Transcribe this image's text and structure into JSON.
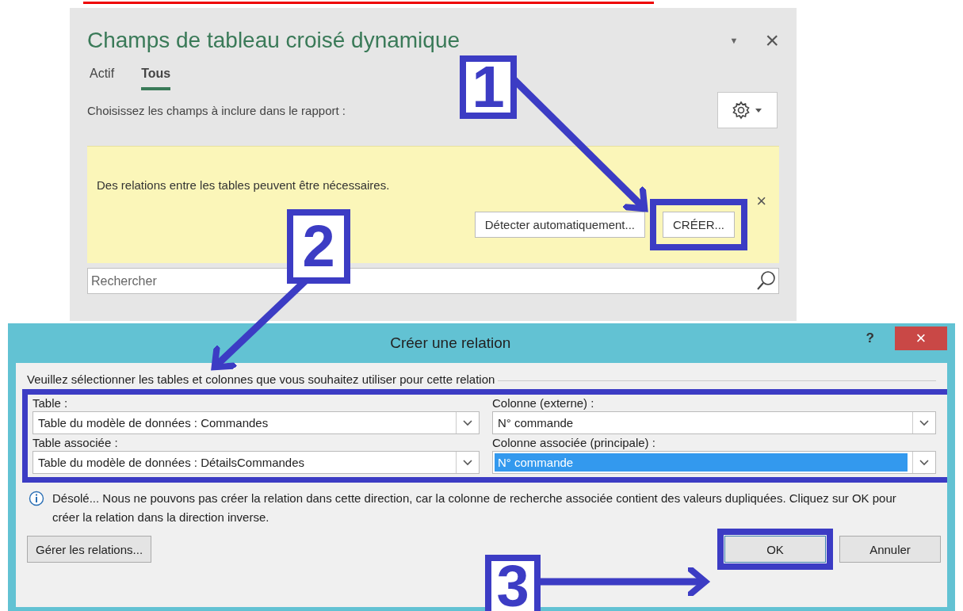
{
  "pane": {
    "title": "Champs de tableau croisé dynamique",
    "menu_caret": "▼",
    "close": "×",
    "tabs": [
      {
        "label": "Actif",
        "selected": false
      },
      {
        "label": "Tous",
        "selected": true
      }
    ],
    "instruction": "Choisissez les champs à inclure dans le rapport :",
    "banner": {
      "message": "Des relations entre les tables peuvent être nécessaires.",
      "close": "×",
      "buttons": [
        "Détecter automatiquement...",
        "CRÉER..."
      ]
    },
    "search": {
      "placeholder": "Rechercher"
    }
  },
  "dialog": {
    "title": "Créer une relation",
    "help": "?",
    "close": "×",
    "group_label": "Veuillez sélectionner les tables et colonnes que vous souhaitez utiliser pour cette relation",
    "fields": [
      {
        "label": "Table :",
        "value": "Table du modèle de données : Commandes",
        "highlighted": false
      },
      {
        "label": "Colonne (externe) :",
        "value": "N° commande",
        "highlighted": false
      },
      {
        "label": "Table associée :",
        "value": "Table du modèle de données : DétailsCommandes",
        "highlighted": false
      },
      {
        "label": "Colonne associée (principale) :",
        "value": "N° commande",
        "highlighted": true
      }
    ],
    "info": "Désolé... Nous ne pouvons pas créer la relation dans cette direction, car la colonne de recherche associée contient des valeurs dupliquées. Cliquez sur OK pour créer la relation dans la direction inverse.",
    "buttons": [
      {
        "label": "Gérer les relations...",
        "kind": "secondary"
      },
      {
        "label": "OK",
        "kind": "primary"
      },
      {
        "label": "Annuler",
        "kind": "secondary"
      }
    ]
  },
  "annotations": [
    "1",
    "2",
    "3"
  ]
}
